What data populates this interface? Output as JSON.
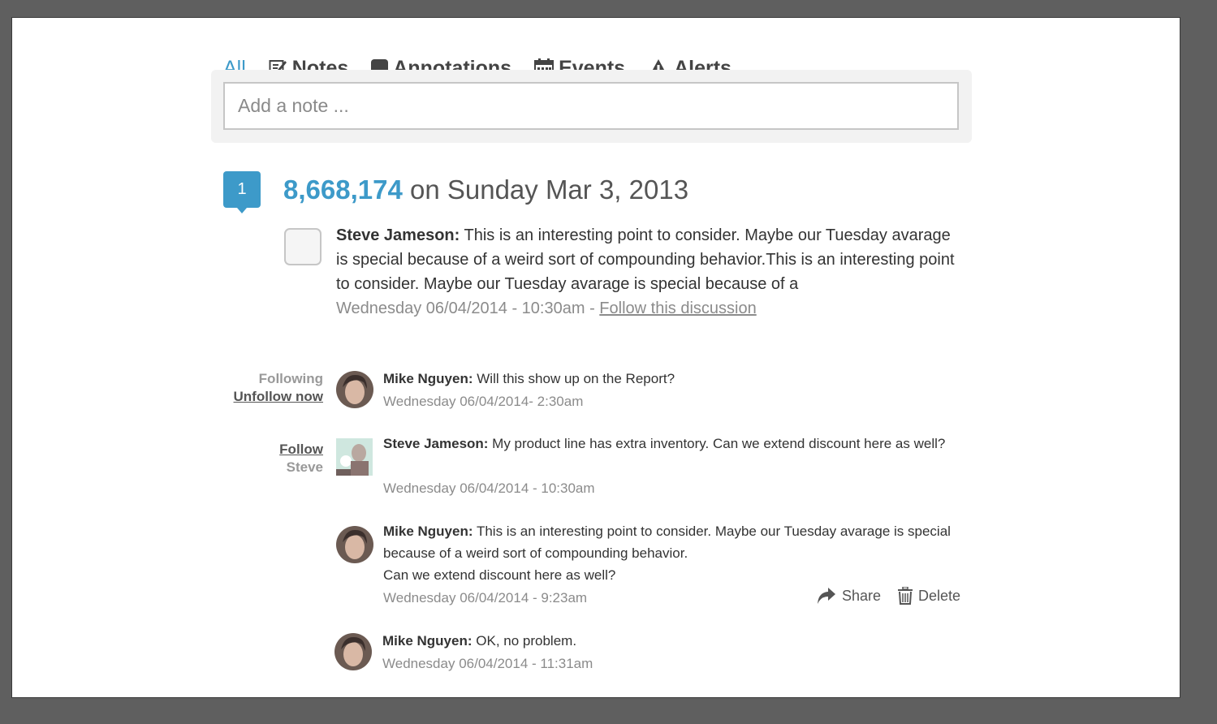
{
  "tabs": [
    {
      "label": "All",
      "icon": "none"
    },
    {
      "label": "Notes",
      "icon": "notes-icon"
    },
    {
      "label": "Annotations",
      "icon": "speech-bubble-icon"
    },
    {
      "label": "Events",
      "icon": "calendar-icon"
    },
    {
      "label": "Alerts",
      "icon": "warning-icon"
    }
  ],
  "note_input": {
    "placeholder": "Add a note ..."
  },
  "annotation": {
    "badge": "1",
    "value": "8,668,174",
    "date_text": " on Sunday Mar 3, 2013"
  },
  "main_comment": {
    "author": "Steve Jameson:",
    "text": " This is an interesting point to consider. Maybe our Tuesday avarage is special because of a weird sort of compounding behavior.This is an interesting point to consider. Maybe our Tuesday avarage is special because of a",
    "timestamp": "Wednesday 06/04/2014 - 10:30am - ",
    "follow_link": "Follow this discussion"
  },
  "side_labels": {
    "following": "Following",
    "unfollow": "Unfollow now",
    "follow": "Follow",
    "follow_name": "Steve"
  },
  "replies": [
    {
      "author": "Mike Nguyen:",
      "text": " Will this show up on the Report?",
      "timestamp": "Wednesday 06/04/2014- 2:30am"
    },
    {
      "author": "Steve Jameson:",
      "text": " My product line has extra inventory. Can we extend discount here as well?",
      "timestamp": "Wednesday 06/04/2014 - 10:30am"
    },
    {
      "author": "Mike Nguyen:",
      "text": " This is an interesting point to consider. Maybe our Tuesday avarage is special because of a weird sort of compounding behavior.",
      "text2": "Can we extend discount here as well?",
      "timestamp": "Wednesday 06/04/2014 - 9:23am"
    },
    {
      "author": "Mike Nguyen:",
      "text": " OK, no problem.",
      "timestamp": "Wednesday 06/04/2014 - 11:31am"
    }
  ],
  "actions": {
    "share": "Share",
    "delete": "Delete"
  },
  "colors": {
    "accent": "#3d9ac9",
    "backdrop": "#5f5f5f",
    "muted": "#8b8b8b"
  }
}
